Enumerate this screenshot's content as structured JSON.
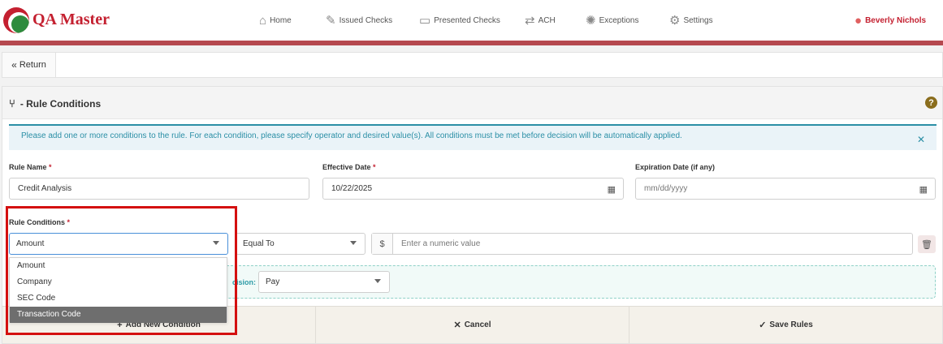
{
  "app": {
    "brand": "QA Master"
  },
  "nav": {
    "items": [
      {
        "label": "Home",
        "icon": "home-icon"
      },
      {
        "label": "Issued Checks",
        "icon": "check-edit-icon"
      },
      {
        "label": "Presented Checks",
        "icon": "check-card-icon"
      },
      {
        "label": "ACH",
        "icon": "ach-transfer-icon"
      },
      {
        "label": "Exceptions",
        "icon": "alert-burst-icon"
      },
      {
        "label": "Settings",
        "icon": "gears-icon"
      }
    ],
    "user": "Beverly Nichols"
  },
  "return_label": "Return",
  "panel": {
    "title": "- Rule Conditions",
    "alert": "Please add one or more conditions to the rule. For each condition, please specify operator and desired value(s). All conditions must be met before decision will be automatically applied."
  },
  "form": {
    "rule_name": {
      "label": "Rule Name",
      "value": "Credit Analysis"
    },
    "effective_date": {
      "label": "Effective Date",
      "value": "10/22/2025"
    },
    "expiration_date": {
      "label": "Expiration Date (if any)",
      "placeholder": "mm/dd/yyyy"
    },
    "rule_conditions": {
      "label": "Rule Conditions",
      "field_selected": "Amount",
      "operator_selected": "Equal To",
      "currency_symbol": "$",
      "value_placeholder": "Enter a numeric value",
      "field_options": [
        "Amount",
        "Company",
        "SEC Code",
        "Transaction Code"
      ],
      "highlighted_option": "Transaction Code"
    },
    "decision": {
      "label_fragment": "cision:",
      "selected": "Pay"
    }
  },
  "footer": {
    "add_condition": "Add New Condition",
    "cancel": "Cancel",
    "save": "Save Rules"
  },
  "colors": {
    "brand_red": "#c42030",
    "header_stripe": "#b5484f",
    "info_teal": "#2b8fa6",
    "annotation_red": "#d41010"
  }
}
